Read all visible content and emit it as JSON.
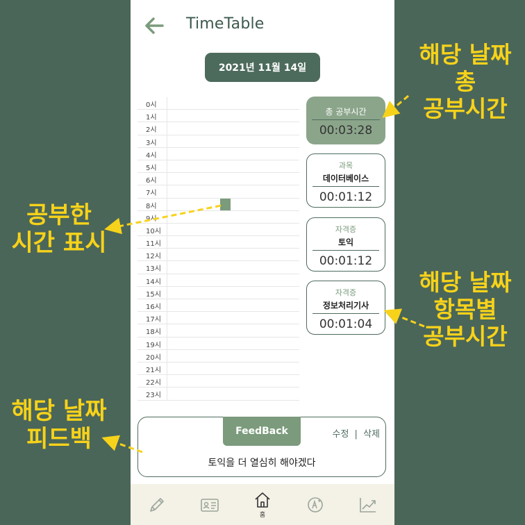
{
  "header": {
    "title": "TimeTable"
  },
  "date_badge": {
    "label": "2021년 11월 14일"
  },
  "timeline": {
    "hours": [
      "0시",
      "1시",
      "2시",
      "3시",
      "4시",
      "5시",
      "6시",
      "7시",
      "8시",
      "9시",
      "10시",
      "11시",
      "12시",
      "13시",
      "14시",
      "15시",
      "16시",
      "17시",
      "18시",
      "19시",
      "20시",
      "21시",
      "22시",
      "23시"
    ]
  },
  "summary": {
    "title": "총 공부시간",
    "time": "00:03:28"
  },
  "subjects": [
    {
      "category": "과목",
      "name": "데이터베이스",
      "time": "00:01:12"
    },
    {
      "category": "자격증",
      "name": "토익",
      "time": "00:01:12"
    },
    {
      "category": "자격증",
      "name": "정보처리기사",
      "time": "00:01:04"
    }
  ],
  "feedback": {
    "tab_label": "FeedBack",
    "edit_label": "수정",
    "separator": "|",
    "delete_label": "삭제",
    "text": "토익을 더 열심히 해야겠다"
  },
  "nav": {
    "items": [
      {
        "icon": "pencil-icon",
        "label": ""
      },
      {
        "icon": "id-card-icon",
        "label": ""
      },
      {
        "icon": "home-icon",
        "label": "홈"
      },
      {
        "icon": "grade-a-plus-icon",
        "label": ""
      },
      {
        "icon": "trend-chart-icon",
        "label": ""
      }
    ]
  },
  "annotations": {
    "total_time": [
      "해당 날짜",
      "총",
      "공부시간"
    ],
    "study_display": [
      "공부한",
      "시간 표시"
    ],
    "per_item": [
      "해당 날짜",
      "항목별",
      "공부시간"
    ],
    "feedback": [
      "해당 날짜",
      "피드백"
    ]
  },
  "colors": {
    "background": "#4a6659",
    "primary": "#4d6b5c",
    "accent": "#7b9b7c",
    "annotation": "#f7d21a",
    "nav_background": "#f4f1e6"
  }
}
